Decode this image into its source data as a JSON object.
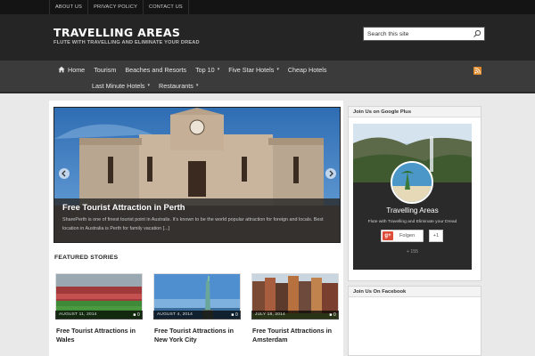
{
  "top_links": [
    "ABOUT US",
    "PRIVACY POLICY",
    "CONTACT US"
  ],
  "header": {
    "title": "TRAVELLING AREAS",
    "tagline": "FLUTE WITH TRAVELLING AND ELIMINATE YOUR DREAD"
  },
  "search": {
    "placeholder": "Search this site",
    "icon": "search-icon"
  },
  "nav": {
    "row1": [
      {
        "label": "Home",
        "icon": "home-icon"
      },
      {
        "label": "Tourism"
      },
      {
        "label": "Beaches and Resorts"
      },
      {
        "label": "Top 10",
        "dropdown": true
      },
      {
        "label": "Five Star Hotels",
        "dropdown": true
      },
      {
        "label": "Cheap Hotels"
      }
    ],
    "row2": [
      {
        "label": "Last Minute Hotels",
        "dropdown": true
      },
      {
        "label": "Restaurants",
        "dropdown": true
      }
    ],
    "rss_icon": "rss-icon"
  },
  "slider": {
    "title": "Free Tourist Attraction in Perth",
    "text": "SharePerth is one of finest tourist point in Australis. It's known to be the world popular attraction for foreign and locals. Best location in Australia is Perth for family vacation [...]"
  },
  "featured": {
    "heading": "FEATURED STORIES",
    "cards": [
      {
        "date": "AUGUST 11, 2014",
        "comments": "0",
        "title": "Free Tourist Attractions in Wales"
      },
      {
        "date": "AUGUST 4, 2014",
        "comments": "0",
        "title": "Free Tourist Attractions in New York City"
      },
      {
        "date": "JULY 18, 2014",
        "comments": "0",
        "title": "Free Tourist Attractions in Amsterdam"
      }
    ]
  },
  "sidebar": {
    "gplus_widget": {
      "title": "Join Us on Google Plus",
      "name": "Travelling Areas",
      "tagline": "Flute with Travelling and Eliminate your Dread",
      "follow_label": "Folgen",
      "plus_one": "+1",
      "count": "+ 155"
    },
    "facebook_widget": {
      "title": "Join Us On Facebook"
    }
  },
  "colors": {
    "header_bg": "#252525",
    "nav_bg": "#3b3b3b",
    "gplus_red": "#dd4b39",
    "rss_orange": "#e08a2c"
  }
}
